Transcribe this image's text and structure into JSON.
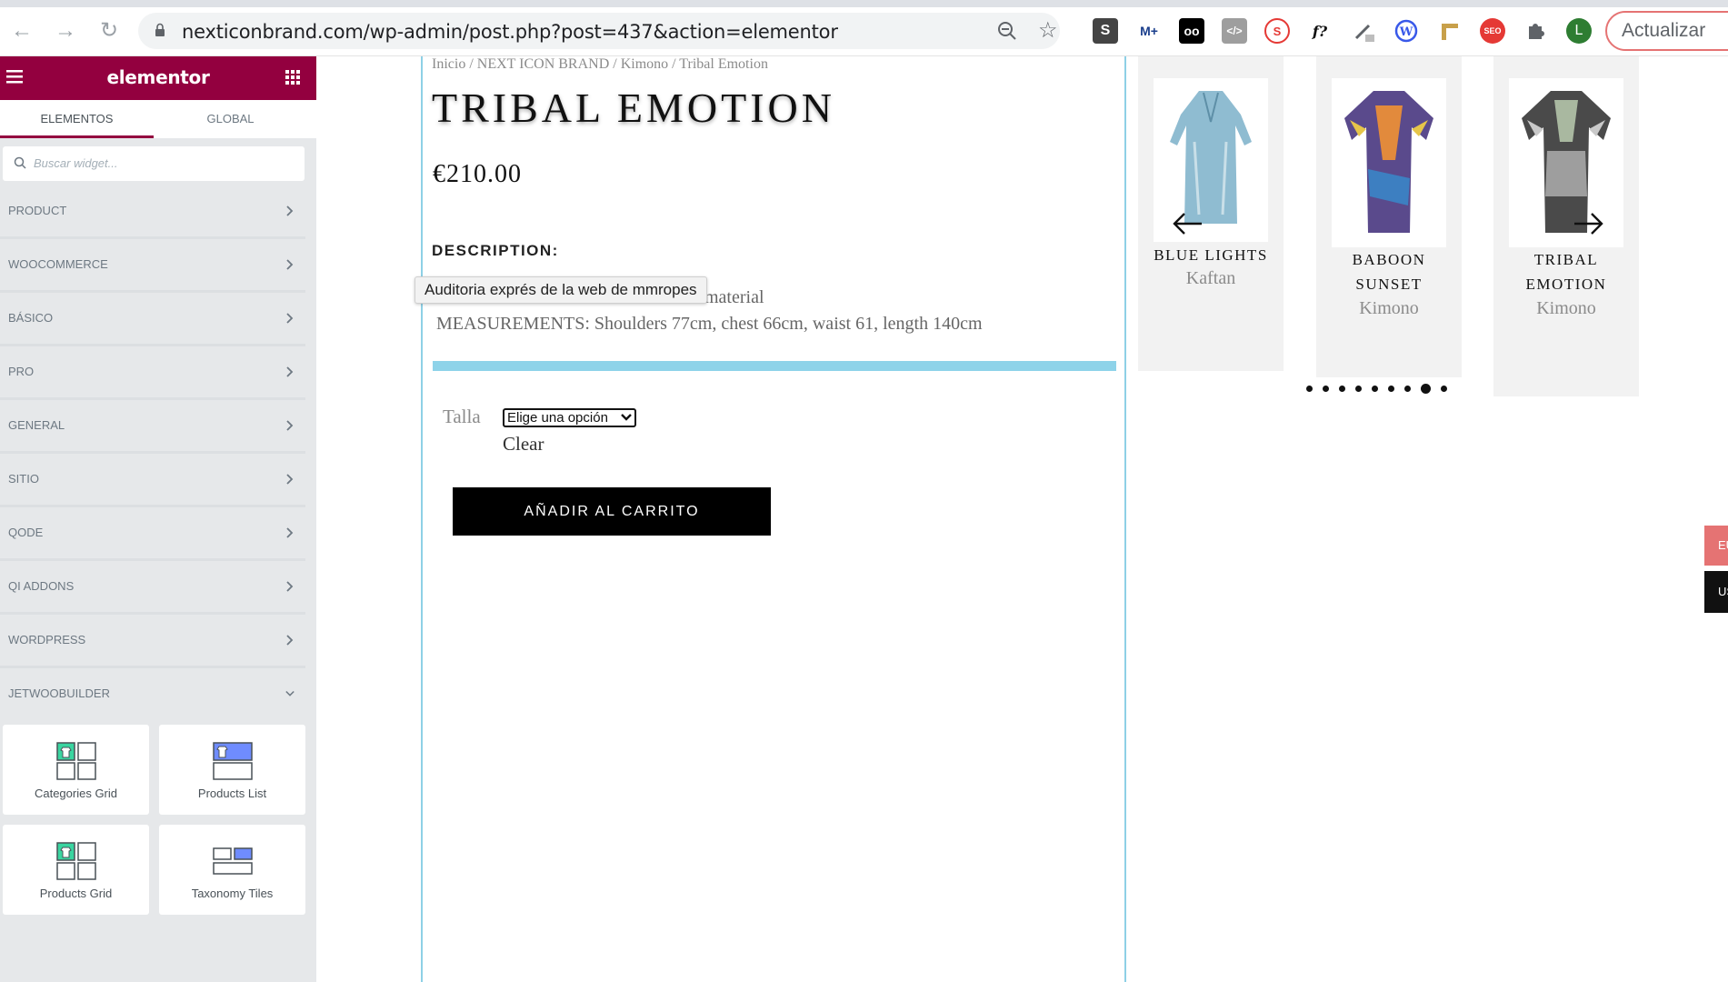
{
  "browser": {
    "url": "nexticonbrand.com/wp-admin/post.php?post=437&action=elementor",
    "update_label": "Actualizar",
    "profile_initial": "L",
    "extensions": [
      "S",
      "M+",
      "oo",
      "</>",
      "S",
      "f?",
      "SEO"
    ]
  },
  "elementor": {
    "logo": "elementor",
    "tabs": [
      "ELEMENTOS",
      "GLOBAL"
    ],
    "search_placeholder": "Buscar widget...",
    "categories": [
      "PRODUCT",
      "WOOCOMMERCE",
      "BÁSICO",
      "PRO",
      "GENERAL",
      "SITIO",
      "QODE",
      "QI ADDONS",
      "WORDPRESS",
      "JETWOOBUILDER"
    ],
    "widgets": [
      "Categories Grid",
      "Products List",
      "Products Grid",
      "Taxonomy Tiles"
    ],
    "brand_color": "#93003f"
  },
  "product": {
    "breadcrumb": "Inicio / NEXT ICON BRAND / Kimono / Tribal Emotion",
    "title": "TRIBAL EMOTION",
    "price": "€210.00",
    "description_heading": "DESCRIPTION:",
    "description_line1": "material",
    "description_line2": "MEASUREMENTS: Shoulders 77cm, chest 66cm, waist 61, length 140cm",
    "tooltip": "Auditoria exprés de la web de mmropes",
    "size_label": "Talla",
    "size_select": "Elige una opción",
    "clear_label": "Clear",
    "add_to_cart": "AÑADIR AL CARRITO"
  },
  "related": [
    {
      "name_line1": "BLUE LIGHTS",
      "name_line2": "",
      "category": "Kaftan"
    },
    {
      "name_line1": "BABOON",
      "name_line2": "SUNSET",
      "category": "Kimono"
    },
    {
      "name_line1": "TRIBAL",
      "name_line2": "EMOTION",
      "category": "Kimono"
    }
  ],
  "slider": {
    "dot_count": 9,
    "active_dot": 8
  },
  "side_tabs": [
    "EU",
    "US"
  ]
}
